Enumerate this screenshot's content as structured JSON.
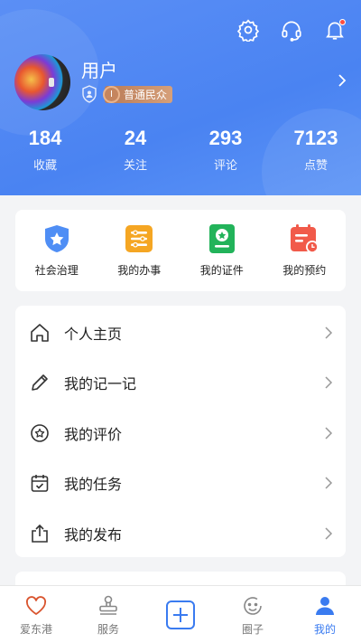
{
  "profile": {
    "username": "用户",
    "level_badge_num": "I",
    "level_badge_text": "普通民众"
  },
  "stats": [
    {
      "value": "184",
      "label": "收藏"
    },
    {
      "value": "24",
      "label": "关注"
    },
    {
      "value": "293",
      "label": "评论"
    },
    {
      "value": "7123",
      "label": "点赞"
    }
  ],
  "quick_actions": [
    {
      "label": "社会治理",
      "icon": "police-shield-icon"
    },
    {
      "label": "我的办事",
      "icon": "task-list-icon"
    },
    {
      "label": "我的证件",
      "icon": "certificate-icon"
    },
    {
      "label": "我的预约",
      "icon": "calendar-clock-icon"
    }
  ],
  "menu": [
    {
      "label": "个人主页",
      "icon": "home-icon"
    },
    {
      "label": "我的记一记",
      "icon": "pencil-icon"
    },
    {
      "label": "我的评价",
      "icon": "star-circle-icon"
    },
    {
      "label": "我的任务",
      "icon": "calendar-check-icon"
    },
    {
      "label": "我的发布",
      "icon": "share-upload-icon"
    }
  ],
  "tabbar": [
    {
      "label": "爱东港",
      "icon": "heart-icon",
      "active": false
    },
    {
      "label": "服务",
      "icon": "stamp-icon",
      "active": false
    },
    {
      "label": "",
      "icon": "plus-square-icon",
      "active": false
    },
    {
      "label": "圈子",
      "icon": "circle-smile-icon",
      "active": false
    },
    {
      "label": "我的",
      "icon": "person-icon",
      "active": true
    }
  ],
  "colors": {
    "primary": "#4a83f2",
    "active_tab": "#3a7bf0",
    "bell_dot": "#ff4d3d",
    "level_badge": "#c5855e"
  }
}
